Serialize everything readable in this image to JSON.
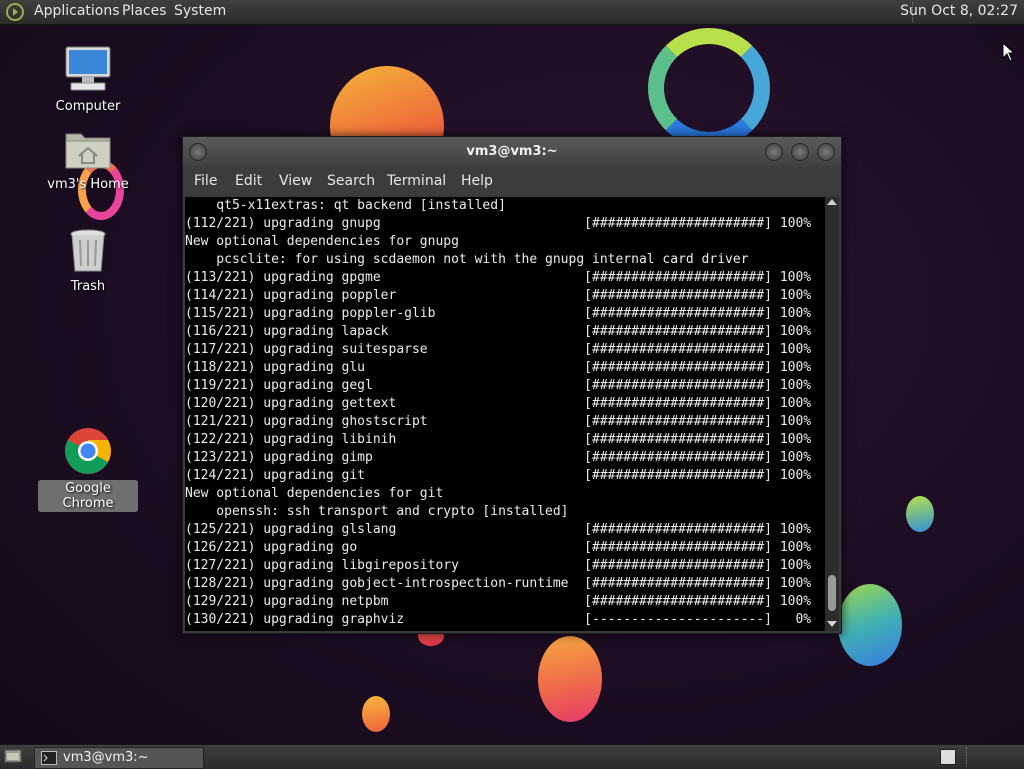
{
  "top_panel": {
    "menus": [
      "Applications",
      "Places",
      "System"
    ],
    "clock": "Sun Oct  8, 02:27"
  },
  "desktop": {
    "icons": [
      {
        "label": "Computer",
        "icon": "computer-icon"
      },
      {
        "label": "vm3's Home",
        "icon": "home-folder-icon"
      },
      {
        "label": "Trash",
        "icon": "trash-icon"
      },
      {
        "label": "Google Chrome",
        "icon": "chrome-icon"
      }
    ]
  },
  "window": {
    "title": "vm3@vm3:~",
    "menu": [
      "File",
      "Edit",
      "View",
      "Search",
      "Terminal",
      "Help"
    ]
  },
  "terminal": {
    "lines": [
      "    qt5-x11extras: qt backend [installed]",
      "(112/221) upgrading gnupg                          [######################] 100%",
      "New optional dependencies for gnupg",
      "    pcsclite: for using scdaemon not with the gnupg internal card driver",
      "(113/221) upgrading gpgme                          [######################] 100%",
      "(114/221) upgrading poppler                        [######################] 100%",
      "(115/221) upgrading poppler-glib                   [######################] 100%",
      "(116/221) upgrading lapack                         [######################] 100%",
      "(117/221) upgrading suitesparse                    [######################] 100%",
      "(118/221) upgrading glu                            [######################] 100%",
      "(119/221) upgrading gegl                           [######################] 100%",
      "(120/221) upgrading gettext                        [######################] 100%",
      "(121/221) upgrading ghostscript                    [######################] 100%",
      "(122/221) upgrading libinih                        [######################] 100%",
      "(123/221) upgrading gimp                           [######################] 100%",
      "(124/221) upgrading git                            [######################] 100%",
      "New optional dependencies for git",
      "    openssh: ssh transport and crypto [installed]",
      "(125/221) upgrading glslang                        [######################] 100%",
      "(126/221) upgrading go                             [######################] 100%",
      "(127/221) upgrading libgirepository                [######################] 100%",
      "(128/221) upgrading gobject-introspection-runtime  [######################] 100%",
      "(129/221) upgrading netpbm                         [######################] 100%",
      "(130/221) upgrading graphviz                       [----------------------]   0%"
    ]
  },
  "taskbar": {
    "tasks": [
      {
        "label": "vm3@vm3:~",
        "icon": "terminal-icon"
      }
    ]
  }
}
